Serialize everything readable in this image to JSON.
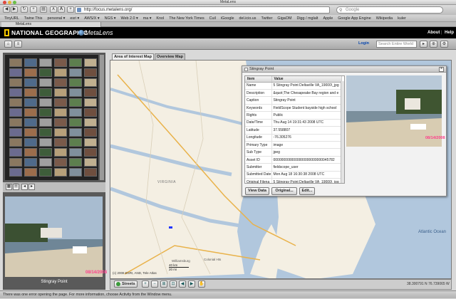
{
  "window": {
    "title": "MetaLens"
  },
  "browser": {
    "url": "http://focus.metalens.org/",
    "search_placeholder": "Google",
    "bookmarks": [
      "TinyURL",
      "Twine This",
      "personal ▾",
      "esri ▾",
      "AWS/X ▾",
      "NGS ▾",
      "Web 2.0 ▾",
      "ma ▾",
      "Knol",
      "The New York Times",
      "Cuil",
      "iGoogle",
      "del.icio.us",
      "Twitter",
      "GigaOM",
      "Digg / mglalt",
      "Apple",
      "Google App Engine",
      "Wikipedia",
      "kuler"
    ],
    "tab_label": "MetaLens"
  },
  "header": {
    "brand": "NATIONAL GEOGRAPHIC",
    "app": "MetaLens",
    "about": "About",
    "help": "Help"
  },
  "toolbar": {
    "login": "Login",
    "search_placeholder": "Search Entire World"
  },
  "left_panel": {
    "selected_caption": "Stingray Point"
  },
  "tabs": [
    "Area of Interest Map",
    "Overview Map"
  ],
  "map": {
    "labels": {
      "virginia": "VIRGINIA",
      "atlantic": "Atlantic Ocean",
      "williamsburg": "Williamsburg",
      "colonial": "Colonial Hts",
      "copyright": "(c) 2008 ESRI, AND, Tele Atlas"
    },
    "scale": {
      "km": "40 km",
      "mi": "20 mi"
    },
    "streets_button": "Streets",
    "coordinates": "38.300791 N 76.739065 W"
  },
  "popup": {
    "title": "Stingray Point",
    "columns": [
      "Item",
      "Value"
    ],
    "rows": [
      [
        "Name",
        "5 Stingray Point Deltaville VA_19000\\_jpg"
      ],
      [
        "Description",
        "&quot;The Chesapeake Bay region and e"
      ],
      [
        "Caption",
        "Stingray Point"
      ],
      [
        "Keywords",
        "FieldScope Student bayside high school"
      ],
      [
        "Rights",
        "Public"
      ],
      [
        "Date/Time",
        "Thu Aug 14 19:31:43 2008 UTC"
      ],
      [
        "Latitude",
        "37.558807"
      ],
      [
        "Longitude",
        "-76.305276"
      ],
      [
        "Primary Type",
        "image"
      ],
      [
        "Sub Type",
        "jpeg"
      ],
      [
        "Asset ID",
        "0000000000000000000000000045782"
      ],
      [
        "Submitter",
        "fieldscope_user"
      ],
      [
        "Submitted Date",
        "Mon Aug 18 16:30:38 2008 UTC"
      ],
      [
        "Original Filena",
        "5 Stingray Point Deltaville VA_19000\\_jpg"
      ]
    ],
    "buttons": [
      "View Data",
      "Original...",
      "Edit..."
    ],
    "photo_date": "08/14/2008"
  },
  "photo": {
    "date": "08/14/2008"
  },
  "status": "There was one error opening the page. For more information, choose Activity from the Window menu.",
  "colors": {
    "water": "#b1c7dd",
    "land": "#f4efe3",
    "header": "#000000",
    "ng_yellow": "#f6c700"
  }
}
